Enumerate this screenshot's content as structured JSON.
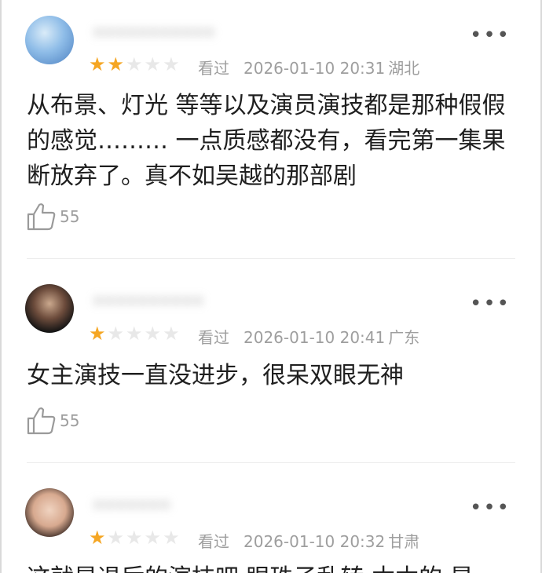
{
  "reviews": [
    {
      "username": "•••••••••••",
      "rating": 2,
      "status": "看过",
      "datetime": "2026-01-10 20:31",
      "location": "湖北",
      "content": "从布景、灯光 等等以及演员演技都是那种假假的感觉……… 一点质感都没有，看完第一集果断放弃了。真不如吴越的那部剧",
      "likes": "55"
    },
    {
      "username": "••••••••••",
      "rating": 1,
      "status": "看过",
      "datetime": "2026-01-10 20:41",
      "location": "广东",
      "content": "女主演技一直没进步，很呆双眼无神",
      "likes": "55"
    },
    {
      "username": "•••••••",
      "rating": 1,
      "status": "看过",
      "datetime": "2026-01-10 20:32",
      "location": "甘肃",
      "content": "这就是退后的演技吧 眼珠子乱转 木木的 是"
    }
  ],
  "icons": {
    "more": "more-dots-icon",
    "like": "thumbs-up-icon",
    "star": "star-icon"
  },
  "colors": {
    "star_on": "#f5a623",
    "star_off": "#e8e8e8",
    "meta_text": "#9e9e9e"
  }
}
